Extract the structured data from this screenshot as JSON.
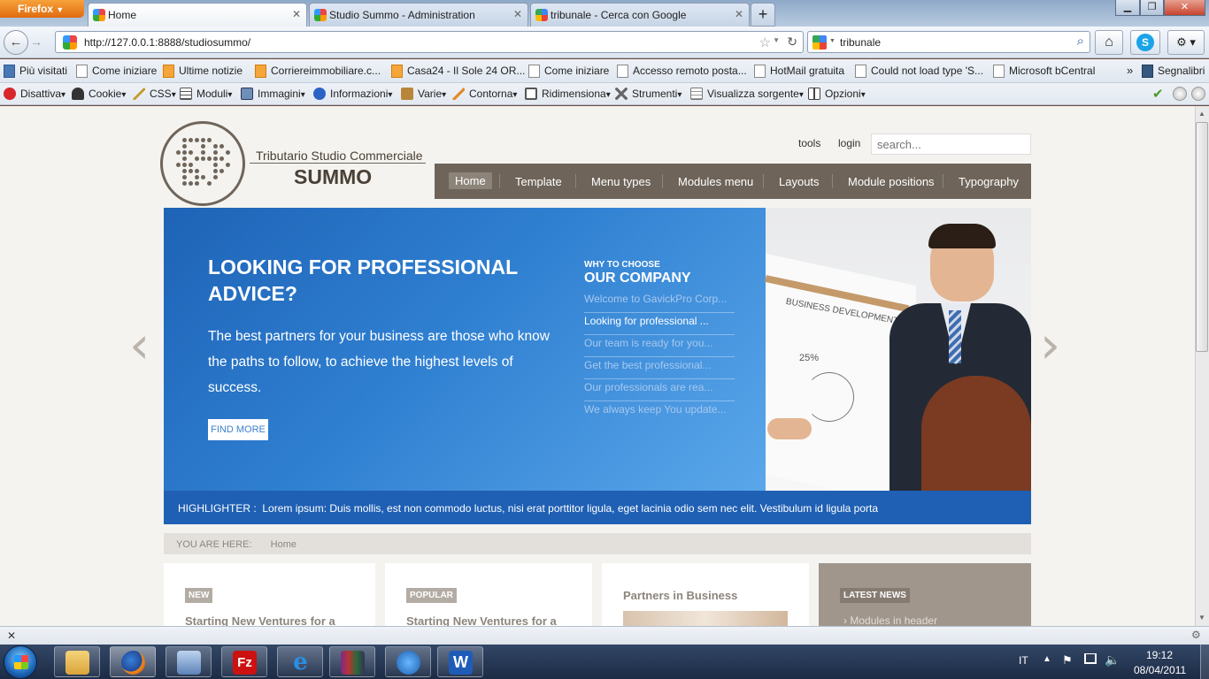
{
  "browser": {
    "app_button": "Firefox",
    "tabs": [
      {
        "label": "Home",
        "active": true
      },
      {
        "label": "Studio Summo - Administration",
        "active": false
      },
      {
        "label": "tribunale - Cerca con Google",
        "active": false
      }
    ],
    "new_tab": "+",
    "url": "http://127.0.0.1:8888/studiosummo/",
    "search_value": "tribunale",
    "bookmarks": [
      "Più visitati",
      "Come iniziare",
      "Ultime notizie",
      "Corriereimmobiliare.c...",
      "Casa24 - Il Sole 24 OR...",
      "Come iniziare",
      "Accesso remoto posta...",
      "HotMail gratuita",
      "Could not load type 'S...",
      "Microsoft bCentral"
    ],
    "bookmarks_overflow": "»",
    "bookmarks_menu": "Segnalibri",
    "webdev_toolbar": [
      "Disattiva",
      "Cookie",
      "CSS",
      "Moduli",
      "Immagini",
      "Informazioni",
      "Varie",
      "Contorna",
      "Ridimensiona",
      "Strumenti",
      "Visualizza sorgente",
      "Opzioni"
    ]
  },
  "site": {
    "logo_line1": "Tributario Studio Commerciale",
    "logo_line2": "SUMMO",
    "top_links": [
      "tools",
      "login"
    ],
    "search_placeholder": "search...",
    "menu": [
      "Home",
      "Template",
      "Menu types",
      "Modules menu",
      "Layouts",
      "Module positions",
      "Typography"
    ],
    "hero": {
      "heading": "LOOKING FOR PROFESSIONAL ADVICE?",
      "body": "The best partners for your business are those who know the paths to follow, to achieve the highest levels of success.",
      "button": "FIND MORE",
      "why_small": "WHY TO CHOOSE",
      "why_big": "OUR COMPANY",
      "list": [
        "Welcome to GavickPro Corp...",
        "Looking for professional ...",
        "Our team is ready for you...",
        "Get the best professional...",
        "Our professionals are rea...",
        "We always keep You update..."
      ],
      "whiteboard_text1": "BUSINESS DEVELOPMENT",
      "whiteboard_text2": "25%"
    },
    "highlighter_label": "HIGHLIGHTER :",
    "highlighter_text": "Lorem ipsum: Duis mollis, est non commodo luctus, nisi erat porttitor ligula, eget lacinia odio sem nec elit. Vestibulum id ligula porta",
    "breadcrumb_label": "YOU ARE HERE:",
    "breadcrumb_item": "Home",
    "boxes": [
      {
        "tag": "NEW",
        "title": "Starting New Ventures for a"
      },
      {
        "tag": "POPULAR",
        "title": "Starting New Ventures for a"
      },
      {
        "title": "Partners in Business"
      },
      {
        "tag": "LATEST NEWS",
        "item": "Modules in header"
      }
    ]
  },
  "taskbar": {
    "language": "IT",
    "time": "19:12",
    "date": "08/04/2011"
  }
}
